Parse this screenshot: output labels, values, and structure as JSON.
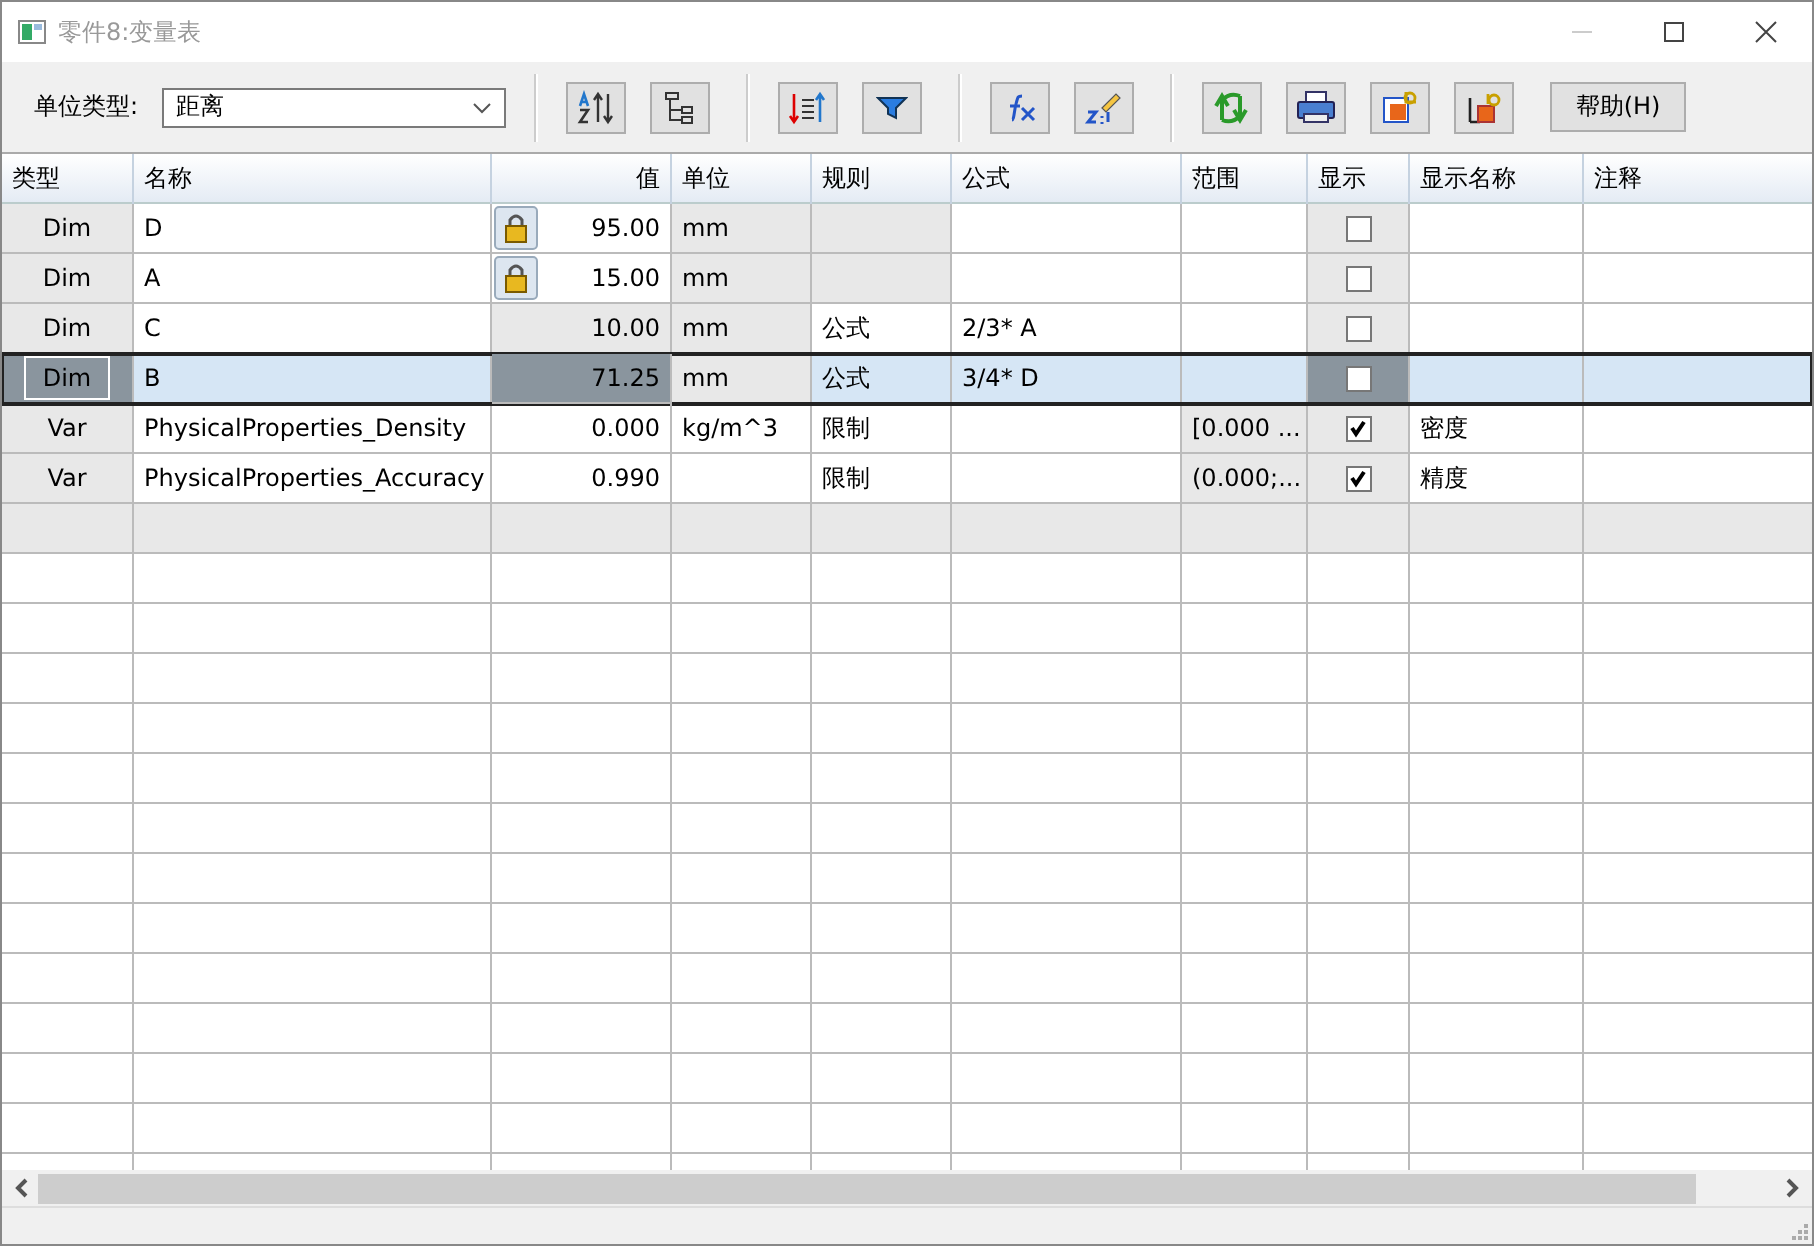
{
  "window": {
    "title": "零件8:变量表"
  },
  "toolbar": {
    "unit_type_label": "单位类型:",
    "unit_type_value": "距离",
    "help_button": "帮助(H)"
  },
  "table": {
    "columns": [
      "类型",
      "名称",
      "值",
      "单位",
      "规则",
      "公式",
      "范围",
      "显示",
      "显示名称",
      "注释"
    ],
    "rows": [
      {
        "kind": "dim",
        "type": "Dim",
        "name": "D",
        "value": "95.00",
        "unit": "mm",
        "rule": "",
        "formula": "",
        "range": "",
        "show": false,
        "display_name": "",
        "locked": true,
        "selected": false
      },
      {
        "kind": "dim",
        "type": "Dim",
        "name": "A",
        "value": "15.00",
        "unit": "mm",
        "rule": "",
        "formula": "",
        "range": "",
        "show": false,
        "display_name": "",
        "locked": true,
        "selected": false
      },
      {
        "kind": "dim",
        "type": "Dim",
        "name": "C",
        "value": "10.00",
        "unit": "mm",
        "rule": "公式",
        "formula": "2/3* A",
        "range": "",
        "show": false,
        "display_name": "",
        "locked": false,
        "selected": false
      },
      {
        "kind": "dim",
        "type": "Dim",
        "name": "B",
        "value": "71.25",
        "unit": "mm",
        "rule": "公式",
        "formula": "3/4* D",
        "range": "",
        "show": false,
        "display_name": "",
        "locked": false,
        "selected": true
      },
      {
        "kind": "var",
        "type": "Var",
        "name": "PhysicalProperties_Density",
        "value": "0.000",
        "unit": "kg/m^3",
        "rule": "限制",
        "formula": "",
        "range": "[0.000 ...",
        "show": true,
        "display_name": "密度",
        "locked": false,
        "selected": false
      },
      {
        "kind": "var",
        "type": "Var",
        "name": "PhysicalProperties_Accuracy",
        "value": "0.990",
        "unit": "",
        "rule": "限制",
        "formula": "",
        "range": "(0.000;...",
        "show": true,
        "display_name": "精度",
        "locked": false,
        "selected": false
      }
    ]
  }
}
